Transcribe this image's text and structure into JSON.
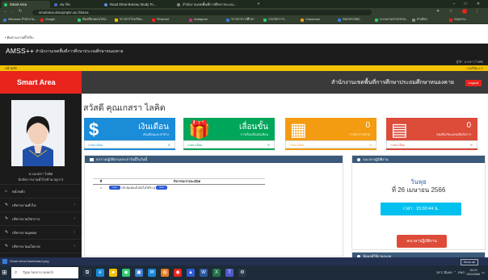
{
  "browser": {
    "tabs": [
      {
        "label": "Smart Area",
        "color": "#2ecc71",
        "active": true
      },
      {
        "label": "สมาร์ท",
        "color": "#4a6cd4",
        "active": false
      },
      {
        "label": "Road Show Bureau Study To...",
        "color": "#5b8fd9",
        "active": false
      },
      {
        "label": "สำนักงานเขตพื้นที่การศึกษาประถม...",
        "color": "#888888",
        "active": false
      }
    ],
    "new_tab": "+",
    "window_controls": [
      "–",
      "□",
      "✕"
    ],
    "url": "smartarea.obecpmpkn.ac.th/area",
    "bookmarks": [
      {
        "label": "Windows สำนักงาน...",
        "color": "#3a7bd5"
      },
      {
        "label": "Google",
        "color": "#e8241d"
      },
      {
        "label": "ห้องเรียนออนไลน์...",
        "color": "#2ecc71"
      },
      {
        "label": "ข่าวสารโรงเรียน...",
        "color": "#f2c200"
      },
      {
        "label": "Pinterest",
        "color": "#e8241d"
      },
      {
        "label": "Instagram",
        "color": "#c13584"
      },
      {
        "label": "ข่าวสารการศึกษา",
        "color": "#3a7bd5"
      },
      {
        "label": "งานวิชาการ...",
        "color": "#2ecc71"
      },
      {
        "label": "Classroom",
        "color": "#f39c12"
      },
      {
        "label": "SNISPCRBC",
        "color": "#3a7bd5"
      },
      {
        "label": "ระบบงานสารบรรณ...",
        "color": "#2ecc71"
      },
      {
        "label": "ตัวเลือก",
        "color": "#888888"
      },
      {
        "label": "กลุ่มงาน...",
        "color": "#e8241d"
      }
    ]
  },
  "breadcrumb": "• ติดตามงานที่ได้รับ",
  "header": {
    "logo": "AMSS++",
    "subtitle": "สำนักงานเขตพื้นที่การศึกษาประถมศึกษาหนองคาย",
    "right_text": "ผู้ใช้ : นางสาว ไลคิต",
    "yellow_left": "หน้าหลัก",
    "yellow_right": "เวอร์ชัน 2.1"
  },
  "sidebar": {
    "brand": "Smart Area",
    "profile_name": "นางเกสรา ไลคิต",
    "profile_role": "นักจัดการงานทั่วไปชำนาญการ",
    "menu": [
      {
        "icon": "home-icon",
        "label": "หน้าหลัก",
        "has_chevron": false
      },
      {
        "icon": "pencil-icon",
        "label": "บริหารงานทั่วไป",
        "has_chevron": true
      },
      {
        "icon": "pencil-icon",
        "label": "บริหารงานวิชาการ",
        "has_chevron": true
      },
      {
        "icon": "pencil-icon",
        "label": "บริหารงานบุคคล",
        "has_chevron": true
      },
      {
        "icon": "pencil-icon",
        "label": "บริหารงานนโยบาย",
        "has_chevron": true
      },
      {
        "icon": "pencil-icon",
        "label": "งานทั้งหมด",
        "has_chevron": true
      }
    ]
  },
  "topnav": {
    "title": "สำนักงานเขตพื้นที่การศึกษาประถมศึกษาหนองคาย",
    "logout": "Logout"
  },
  "main": {
    "welcome": "สวัสดี คุณเกสรา ไลคิต",
    "cards": [
      {
        "big": "เงินเดือน",
        "small": "เงินเดือนและค่าจ้าง",
        "icon": "$",
        "icon_name": "dollar-icon",
        "footer": "รายละเอียด",
        "color": "#1a8cd8"
      },
      {
        "big": "เลื่อนขั้น",
        "small": "การเลื่อนขั้นเงินเดือน",
        "icon": "🎁",
        "icon_name": "gift-icon",
        "footer": "รายละเอียด",
        "color": "#00a65a"
      },
      {
        "big": "0",
        "small": "การลา/การขาด",
        "icon": "▦",
        "icon_name": "calendar-icon",
        "footer": "รายละเอียด",
        "color": "#f39c12"
      },
      {
        "big": "0",
        "small": "หนังสือเวียน/หนังสือสั่งการ",
        "icon": "▤",
        "icon_name": "document-icon",
        "footer": "รายละเอียด",
        "color": "#dd4b39"
      }
    ],
    "panel_left": {
      "title": "ตารางปฏิบัติงานประจำวันนี้ในวันนี้",
      "columns": [
        "ที่",
        "กิจกรรม/รายละเอียด"
      ],
      "rows": [
        {
          "no": "1",
          "activity": "ประชุมออนไลน์/ไม่ได้ระบุ",
          "badge": "new"
        }
      ]
    },
    "panel_right": {
      "title": "ลงเวลาปฏิบัติงาน",
      "day": "วันพุธ",
      "date": "ที่ 26 เมษายน 2566",
      "time_button": "เวลา : 15:00:44 น.",
      "action_button": "ลงเวลาปฏิบัติงาน"
    },
    "panel_right_2": {
      "title": "ข้อมูลผู้ใช้งานระบบ"
    }
  },
  "bottom_bar": {
    "left": "Smart Area Dashboard.png",
    "right": "Show all"
  },
  "taskbar": {
    "search_placeholder": "Type here to search",
    "tray_weather": "28°C มีแดด",
    "tray_time": "15:00",
    "tray_date": "26/4/2566",
    "tray_lang": "ENG"
  }
}
